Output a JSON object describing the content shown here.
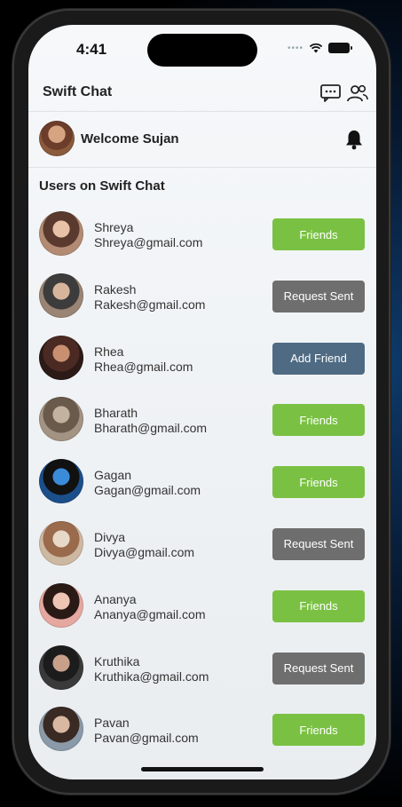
{
  "status_bar": {
    "time": "4:41"
  },
  "header": {
    "title": "Swift Chat"
  },
  "welcome": {
    "text": "Welcome Sujan"
  },
  "section": {
    "title": "Users on Swift Chat"
  },
  "users": [
    {
      "name": "Shreya",
      "email": "Shreya@gmail.com",
      "action": "Friends",
      "kind": "friends",
      "avatar_colors": [
        "#e8c2a8",
        "#5a3a2e",
        "#b38b74"
      ]
    },
    {
      "name": "Rakesh",
      "email": "Rakesh@gmail.com",
      "action": "Request Sent",
      "kind": "sent",
      "avatar_colors": [
        "#d7b59c",
        "#3c3c3c",
        "#9a8474"
      ]
    },
    {
      "name": "Rhea",
      "email": "Rhea@gmail.com",
      "action": "Add Friend",
      "kind": "add",
      "avatar_colors": [
        "#c89070",
        "#4a2a22",
        "#2b1a16"
      ]
    },
    {
      "name": "Bharath",
      "email": "Bharath@gmail.com",
      "action": "Friends",
      "kind": "friends",
      "avatar_colors": [
        "#c4b2a0",
        "#6a5a4c",
        "#a39383"
      ]
    },
    {
      "name": "Gagan",
      "email": "Gagan@gmail.com",
      "action": "Friends",
      "kind": "friends",
      "avatar_colors": [
        "#3a8bd8",
        "#111111",
        "#1b4f8a"
      ]
    },
    {
      "name": "Divya",
      "email": "Divya@gmail.com",
      "action": "Request Sent",
      "kind": "sent",
      "avatar_colors": [
        "#e8d8c8",
        "#9a6a4c",
        "#cdb8a2"
      ]
    },
    {
      "name": "Ananya",
      "email": "Ananya@gmail.com",
      "action": "Friends",
      "kind": "friends",
      "avatar_colors": [
        "#eec4b4",
        "#2a1a16",
        "#e4a8a0"
      ]
    },
    {
      "name": "Kruthika",
      "email": "Kruthika@gmail.com",
      "action": "Request Sent",
      "kind": "sent",
      "avatar_colors": [
        "#c8a08a",
        "#1c1c1c",
        "#3a3a3a"
      ]
    },
    {
      "name": "Pavan",
      "email": "Pavan@gmail.com",
      "action": "Friends",
      "kind": "friends",
      "avatar_colors": [
        "#d8b8a0",
        "#3a2a24",
        "#8a9aa8"
      ]
    }
  ],
  "colors": {
    "friends": "#7ac143",
    "sent": "#6e6e6e",
    "add": "#4f6b84"
  },
  "icons": {
    "header_left": "chat-bubble-icon",
    "header_right": "people-icon",
    "welcome_right": "bell-icon",
    "status": [
      "signal-dots-icon",
      "wifi-icon",
      "battery-icon"
    ]
  }
}
